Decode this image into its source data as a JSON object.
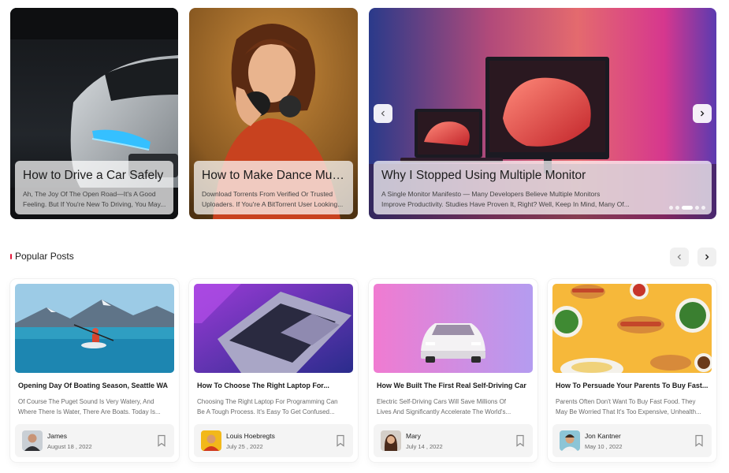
{
  "hero": [
    {
      "title": "How to Drive a Car Safely",
      "desc": [
        "Ah, The Joy Of The Open Road—It's A Good",
        "Feeling. But If You're New To Driving, You May..."
      ]
    },
    {
      "title": "How to Make Dance Music",
      "desc": [
        "Download Torrents From Verified Or Trusted",
        "Uploaders. If You're A BitTorrent User Looking..."
      ]
    },
    {
      "title": "Why I Stopped Using Multiple Monitor",
      "desc": [
        "A Single Monitor Manifesto — Many Developers Believe Multiple Monitors",
        "Improve Productivity. Studies Have Proven It, Right? Well, Keep In Mind, Many Of..."
      ]
    }
  ],
  "hero_carousel": {
    "prev_icon": "chevron-left-icon",
    "next_icon": "chevron-right-icon",
    "slide_count": 6,
    "active_slide": 3
  },
  "section": {
    "title": "Popular Posts",
    "accent_color": "#e5183b"
  },
  "cards": [
    {
      "title": "Opening Day Of Boating Season, Seattle WA",
      "desc": [
        "Of Course The Puget Sound Is Very Watery, And",
        "Where There Is Water, There Are Boats. Today Is..."
      ],
      "author": "James",
      "date": "August 18 , 2022"
    },
    {
      "title": "How To Choose The Right Laptop For...",
      "desc": [
        "Choosing The Right Laptop For Programming Can",
        "Be A Tough Process. It's Easy To Get Confused..."
      ],
      "author": "Louis Hoebregts",
      "date": "July 25 , 2022"
    },
    {
      "title": "How We Built The First Real Self-Driving Car",
      "desc": [
        "Electric Self-Driving Cars Will Save Millions Of",
        "Lives And Significantly Accelerate The World's..."
      ],
      "author": "Mary",
      "date": "July 14 , 2022"
    },
    {
      "title": "How To Persuade Your Parents To Buy Fast...",
      "desc": [
        "Parents Often Don't Want To Buy Fast Food. They",
        "May Be Worried That It's Too Expensive, Unhealth..."
      ],
      "author": "Jon Kantner",
      "date": "May 10 , 2022"
    }
  ]
}
